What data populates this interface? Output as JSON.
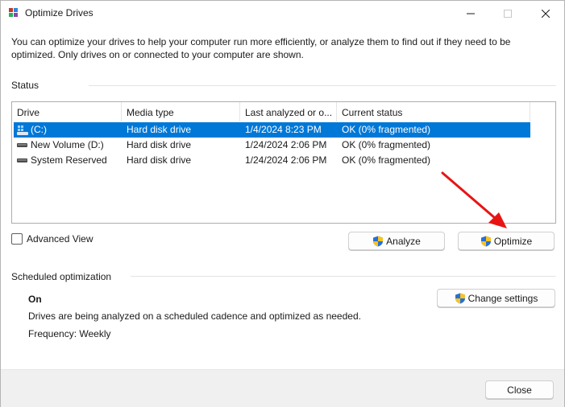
{
  "window": {
    "title": "Optimize Drives"
  },
  "intro_text": "You can optimize your drives to help your computer run more efficiently, or analyze them to find out if they need to be optimized. Only drives on or connected to your computer are shown.",
  "status": {
    "label": "Status",
    "columns": [
      "Drive",
      "Media type",
      "Last analyzed or o...",
      "Current status"
    ],
    "rows": [
      {
        "drive": "(C:)",
        "media": "Hard disk drive",
        "last": "1/4/2024 8:23 PM",
        "status": "OK (0% fragmented)",
        "selected": true
      },
      {
        "drive": "New Volume (D:)",
        "media": "Hard disk drive",
        "last": "1/24/2024 2:06 PM",
        "status": "OK (0% fragmented)",
        "selected": false
      },
      {
        "drive": "System Reserved",
        "media": "Hard disk drive",
        "last": "1/24/2024 2:06 PM",
        "status": "OK (0% fragmented)",
        "selected": false
      }
    ],
    "advanced_view_label": "Advanced View",
    "advanced_view_checked": false,
    "analyze_label": "Analyze",
    "optimize_label": "Optimize"
  },
  "scheduled": {
    "label": "Scheduled optimization",
    "state": "On",
    "description": "Drives are being analyzed on a scheduled cadence and optimized as needed.",
    "frequency": "Frequency: Weekly",
    "change_settings_label": "Change settings"
  },
  "footer": {
    "close_label": "Close"
  },
  "colors": {
    "selection": "#0078d7",
    "annotation_arrow": "#e81414"
  }
}
